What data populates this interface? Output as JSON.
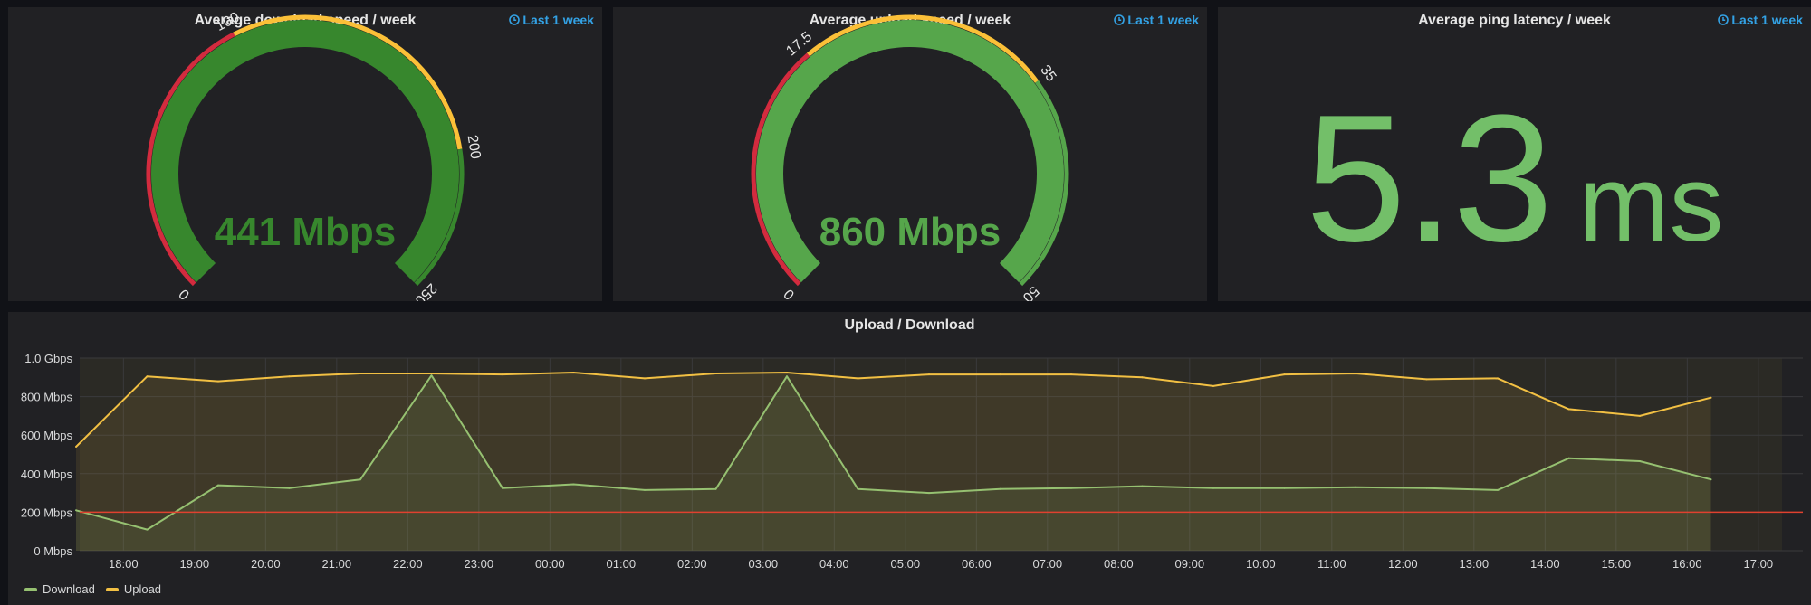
{
  "colors": {
    "panel_bg": "#212124",
    "page_bg": "#111217",
    "red": "#d32b3e",
    "yellow": "#fbc038",
    "green_dark": "#37872d",
    "green_light": "#56a64b",
    "stat_green": "#73bf69",
    "series_download": "#96c171",
    "series_upload": "#f2c043",
    "threshold": "#e0412f",
    "link": "#33a2e5"
  },
  "panels": {
    "download_gauge": {
      "title": "Average download speed / week",
      "time_info": "Last 1 week",
      "value_text": "441 Mbps",
      "value": 441,
      "min": 0,
      "max": 250,
      "thresholds": [
        100,
        200
      ],
      "tick_labels": [
        "0",
        "100",
        "200",
        "250"
      ],
      "fill_color": "#37872d"
    },
    "upload_gauge": {
      "title": "Average upload speed / week",
      "time_info": "Last 1 week",
      "value_text": "860 Mbps",
      "value": 860,
      "min": 0,
      "max": 50,
      "thresholds": [
        17.5,
        35
      ],
      "tick_labels": [
        "0",
        "17.5",
        "35",
        "50"
      ],
      "fill_color": "#56a64b"
    },
    "ping_stat": {
      "title": "Average ping latency / week",
      "time_info": "Last 1 week",
      "value": "5.3",
      "unit": "ms"
    },
    "graph": {
      "title": "Upload / Download",
      "legend": [
        {
          "label": "Download",
          "color": "#96c171"
        },
        {
          "label": "Upload",
          "color": "#f2c043"
        }
      ]
    }
  },
  "chart_data": {
    "type": "line",
    "title": "Upload / Download",
    "x": [
      "17:20",
      "18:20",
      "19:20",
      "20:20",
      "21:20",
      "22:20",
      "23:20",
      "00:20",
      "01:20",
      "02:20",
      "03:20",
      "04:20",
      "05:20",
      "06:20",
      "07:20",
      "08:20",
      "09:20",
      "10:20",
      "11:20",
      "12:20",
      "13:20",
      "14:20",
      "15:20",
      "16:20",
      "16:40"
    ],
    "xlabels": [
      "18:00",
      "19:00",
      "20:00",
      "21:00",
      "22:00",
      "23:00",
      "00:00",
      "01:00",
      "02:00",
      "03:00",
      "04:00",
      "05:00",
      "06:00",
      "07:00",
      "08:00",
      "09:00",
      "10:00",
      "11:00",
      "12:00",
      "13:00",
      "14:00",
      "15:00",
      "16:00",
      "17:00"
    ],
    "series": [
      {
        "name": "Download",
        "unit": "Mbps",
        "values": [
          210,
          110,
          340,
          325,
          370,
          910,
          325,
          345,
          315,
          320,
          905,
          320,
          300,
          320,
          325,
          335,
          325,
          325,
          330,
          325,
          315,
          480,
          465,
          370
        ]
      },
      {
        "name": "Upload",
        "unit": "Mbps",
        "values": [
          540,
          905,
          880,
          905,
          920,
          920,
          915,
          925,
          895,
          920,
          925,
          895,
          915,
          915,
          915,
          900,
          855,
          915,
          920,
          890,
          895,
          735,
          700,
          795
        ]
      }
    ],
    "threshold": 200,
    "ylabels": [
      "0 Mbps",
      "200 Mbps",
      "400 Mbps",
      "600 Mbps",
      "800 Mbps",
      "1.0 Gbps"
    ],
    "ylim": [
      0,
      1000
    ],
    "grid": true,
    "legend_position": "bottom-left"
  }
}
